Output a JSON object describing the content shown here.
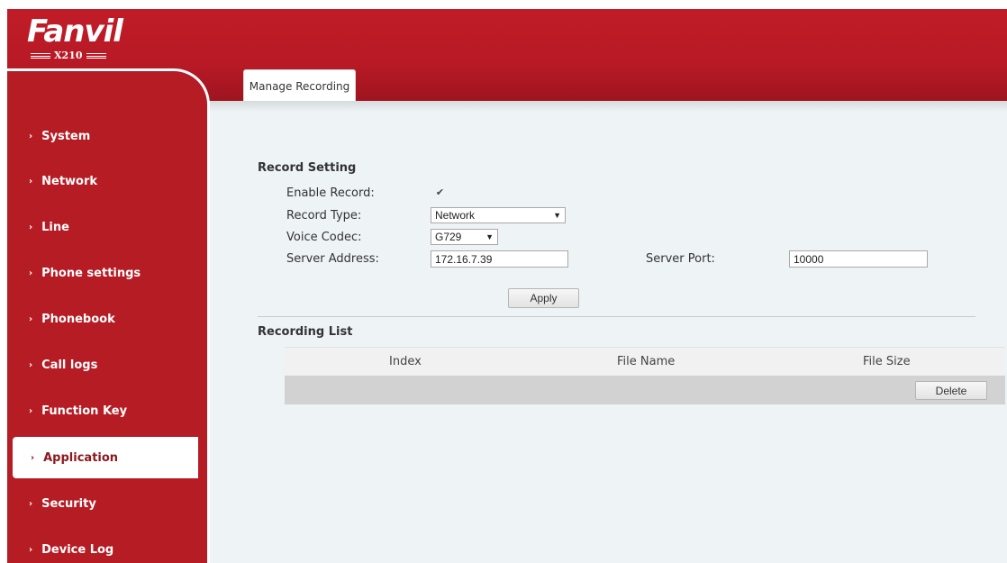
{
  "brand": {
    "logo": "Fanvil",
    "model": "X210"
  },
  "nav": {
    "items": [
      {
        "label": "System"
      },
      {
        "label": "Network"
      },
      {
        "label": "Line"
      },
      {
        "label": "Phone settings"
      },
      {
        "label": "Phonebook"
      },
      {
        "label": "Call logs"
      },
      {
        "label": "Function Key"
      },
      {
        "label": "Application",
        "active": true
      },
      {
        "label": "Security"
      },
      {
        "label": "Device Log"
      }
    ]
  },
  "tabs": [
    {
      "label": "Manage Recording",
      "active": true
    }
  ],
  "record_setting": {
    "title": "Record Setting",
    "enable_record": {
      "label": "Enable Record:",
      "checked": true
    },
    "record_type": {
      "label": "Record Type:",
      "value": "Network"
    },
    "voice_codec": {
      "label": "Voice Codec:",
      "value": "G729"
    },
    "server_address": {
      "label": "Server Address:",
      "value": "172.16.7.39"
    },
    "server_port": {
      "label": "Server Port:",
      "value": "10000"
    },
    "apply_label": "Apply"
  },
  "recording_list": {
    "title": "Recording List",
    "columns": [
      "Index",
      "File Name",
      "File Size"
    ],
    "delete_label": "Delete"
  },
  "colors": {
    "brand_red": "#b51c24",
    "content_bg": "#eef3f6"
  }
}
